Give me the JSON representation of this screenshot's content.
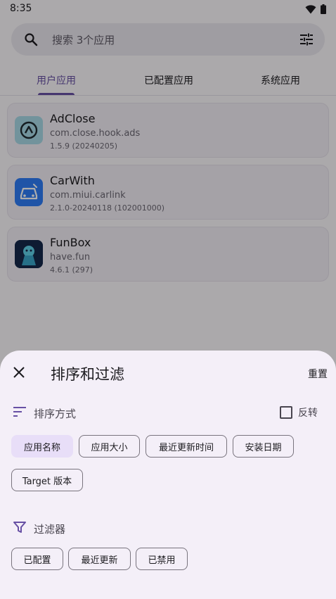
{
  "status_bar": {
    "time": "8:35",
    "wifi_icon": "wifi-icon",
    "battery_icon": "battery-icon"
  },
  "search": {
    "placeholder": "搜索 3个应用",
    "icon": "search-icon",
    "filter_icon": "tune-icon"
  },
  "tabs": [
    {
      "label": "用户应用",
      "active": true
    },
    {
      "label": "已配置应用",
      "active": false
    },
    {
      "label": "系统应用",
      "active": false
    }
  ],
  "apps": [
    {
      "name": "AdClose",
      "package": "com.close.hook.ads",
      "version": "1.5.9 (20240205)",
      "icon": "adclose-app-icon"
    },
    {
      "name": "CarWith",
      "package": "com.miui.carlink",
      "version": "2.1.0-20240118 (102001000)",
      "icon": "carwith-app-icon"
    },
    {
      "name": "FunBox",
      "package": "have.fun",
      "version": "4.6.1 (297)",
      "icon": "funbox-app-icon"
    }
  ],
  "sheet": {
    "title": "排序和过滤",
    "reset_label": "重置",
    "sort": {
      "label": "排序方式",
      "reverse_label": "反转",
      "reverse_checked": false,
      "options": [
        {
          "label": "应用名称",
          "selected": true
        },
        {
          "label": "应用大小",
          "selected": false
        },
        {
          "label": "最近更新时间",
          "selected": false
        },
        {
          "label": "安装日期",
          "selected": false
        },
        {
          "label": "Target 版本",
          "selected": false
        }
      ]
    },
    "filter": {
      "label": "过滤器",
      "options": [
        {
          "label": "已配置",
          "selected": false
        },
        {
          "label": "最近更新",
          "selected": false
        },
        {
          "label": "已禁用",
          "selected": false
        }
      ]
    }
  },
  "colors": {
    "accent": "#6750a4",
    "chip_selected": "#e8def8",
    "sheet_bg": "#f4eff8"
  }
}
